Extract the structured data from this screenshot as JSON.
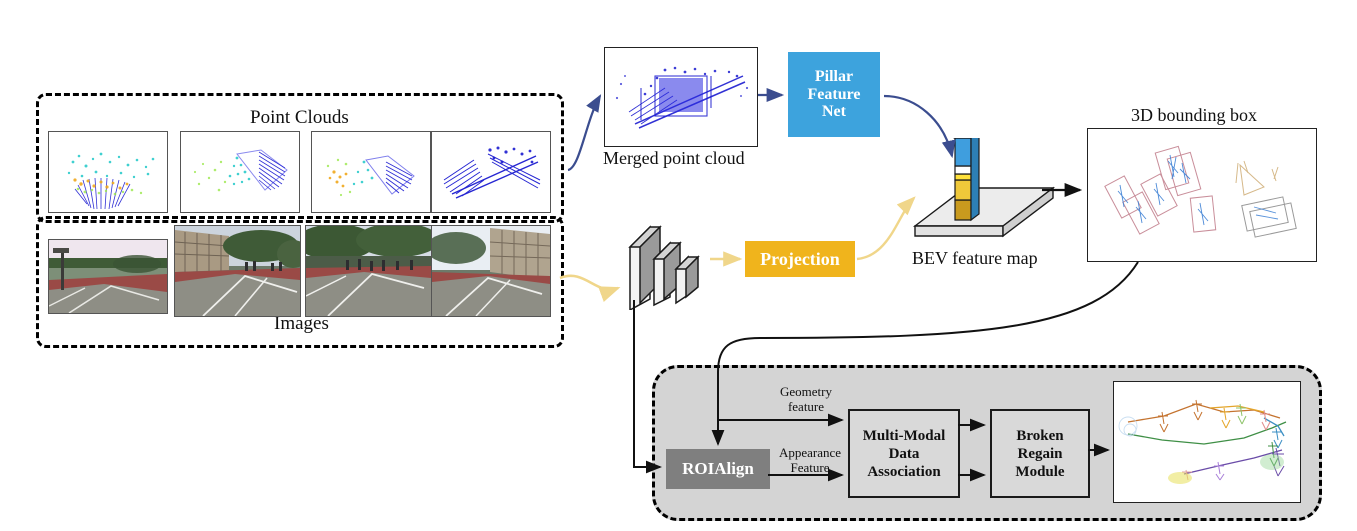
{
  "figure": {
    "domain": "pipeline-diagram",
    "title_absent": true
  },
  "inputs": {
    "point_clouds_label": "Point Clouds",
    "images_label": "Images",
    "point_cloud_thumb_count": 4,
    "image_thumb_count": 4
  },
  "lidar_branch": {
    "merged_label": "Merged point cloud",
    "pillar_net_label": "Pillar\nFeature\nNet",
    "pillar_net_line1": "Pillar",
    "pillar_net_line2": "Feature",
    "pillar_net_line3": "Net",
    "pillar_net_color": "#3da3dd",
    "bev_label": "BEV feature map",
    "bev_slab_color": "#e6e6e6",
    "pillar_stack_colors": [
      "#3f9ede",
      "#ffffff",
      "#ffe13a",
      "#efc83a",
      "#c99a1e"
    ]
  },
  "camera_branch": {
    "projection_label": "Projection",
    "projection_color": "#f0b41c",
    "cnn_slab_color": "#9a9a9a"
  },
  "detection": {
    "bbox_label": "3D bounding box"
  },
  "tracking_module": {
    "roialign_label": "ROIAlign",
    "roialign_color": "#7f7f7f",
    "geometry_feature_line1": "Geometry",
    "geometry_feature_line2": "feature",
    "appearance_feature_line1": "Appearance",
    "appearance_feature_line2": "Feature",
    "mmda_line1": "Multi-Modal",
    "mmda_line2": "Data",
    "mmda_line3": "Association",
    "brm_line1": "Broken",
    "brm_line2": "Regain",
    "brm_line3": "Module",
    "panel_color": "#d4d4d4",
    "box_fill": "#d9d9d9"
  },
  "arrows": {
    "lidar_curve_color": "#3b4d8f",
    "camera_curve_color": "#f2dd8e",
    "black": "#111111"
  }
}
